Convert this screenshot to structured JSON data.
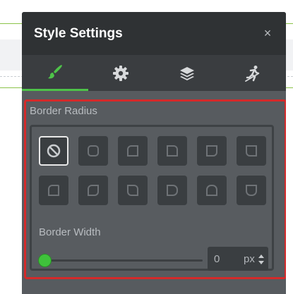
{
  "panel": {
    "title": "Style Settings",
    "close_glyph": "×"
  },
  "tabs": [
    {
      "name": "style",
      "icon": "paintbrush-icon",
      "active": true
    },
    {
      "name": "settings",
      "icon": "gear-icon",
      "active": false
    },
    {
      "name": "layers",
      "icon": "layers-icon",
      "active": false
    },
    {
      "name": "motion",
      "icon": "running-person-icon",
      "active": false
    }
  ],
  "border_radius": {
    "label": "Border Radius",
    "options": [
      "none",
      "all",
      "top-left",
      "top-right",
      "bottom-right",
      "bottom-left",
      "top",
      "right",
      "bottom",
      "left",
      "top-alt",
      "bottom-alt"
    ],
    "selected": "none"
  },
  "border_width": {
    "label": "Border Width",
    "value": "0",
    "unit": "px",
    "slider_level": 0
  },
  "colors": {
    "accent": "#4ec349",
    "highlight": "#d42a2a",
    "panel": "#575b5f",
    "header": "#2f3234"
  }
}
